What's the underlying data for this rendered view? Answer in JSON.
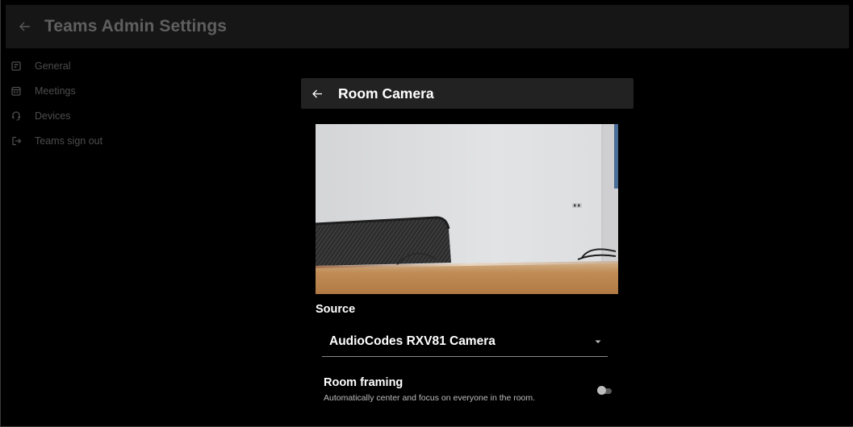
{
  "header": {
    "title": "Teams Admin Settings",
    "back_icon": "arrow-left-icon"
  },
  "sidebar": {
    "items": [
      {
        "label": "General",
        "icon": "general-settings-icon"
      },
      {
        "label": "Meetings",
        "icon": "calendar-icon"
      },
      {
        "label": "Devices",
        "icon": "headset-icon"
      },
      {
        "label": "Teams sign out",
        "icon": "sign-out-icon"
      }
    ]
  },
  "panel": {
    "title": "Room Camera",
    "back_icon": "arrow-left-icon",
    "preview_image": "camera-preview",
    "source_label": "Source",
    "source_value": "AudioCodes RXV81 Camera",
    "caret_icon": "dropdown-caret-icon",
    "room_framing": {
      "title": "Room framing",
      "description": "Automatically center and focus on everyone in the room.",
      "enabled": false
    }
  },
  "colors": {
    "background": "#000000",
    "topbar": "#161616",
    "panel_header": "#222222",
    "primary_text": "#ffffff",
    "dim_text": "#4d4d4d"
  }
}
